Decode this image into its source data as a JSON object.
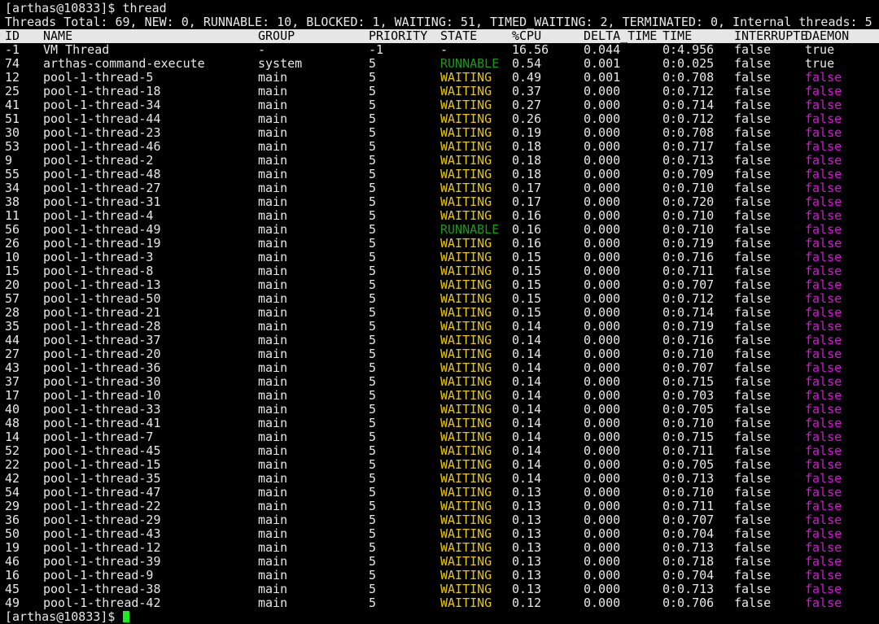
{
  "prompt": "[arthas@10833]$",
  "command": "thread",
  "summary": "Threads Total: 69, NEW: 0, RUNNABLE: 10, BLOCKED: 1, WAITING: 51, TIMED_WAITING: 2, TERMINATED: 0, Internal threads: 5",
  "columns": [
    "ID",
    "NAME",
    "GROUP",
    "PRIORITY",
    "STATE",
    "%CPU",
    "DELTA_TIME",
    "TIME",
    "INTERRUPTE",
    "DAEMON"
  ],
  "rows": [
    [
      "-1",
      "VM Thread",
      "-",
      "-1",
      "-",
      "16.56",
      "0.044",
      "0:4.956",
      "false",
      "true"
    ],
    [
      "74",
      "arthas-command-execute",
      "system",
      "5",
      "RUNNABLE",
      "0.54",
      "0.001",
      "0:0.025",
      "false",
      "true"
    ],
    [
      "12",
      "pool-1-thread-5",
      "main",
      "5",
      "WAITING",
      "0.49",
      "0.001",
      "0:0.708",
      "false",
      "false"
    ],
    [
      "25",
      "pool-1-thread-18",
      "main",
      "5",
      "WAITING",
      "0.37",
      "0.000",
      "0:0.712",
      "false",
      "false"
    ],
    [
      "41",
      "pool-1-thread-34",
      "main",
      "5",
      "WAITING",
      "0.27",
      "0.000",
      "0:0.714",
      "false",
      "false"
    ],
    [
      "51",
      "pool-1-thread-44",
      "main",
      "5",
      "WAITING",
      "0.26",
      "0.000",
      "0:0.712",
      "false",
      "false"
    ],
    [
      "30",
      "pool-1-thread-23",
      "main",
      "5",
      "WAITING",
      "0.19",
      "0.000",
      "0:0.708",
      "false",
      "false"
    ],
    [
      "53",
      "pool-1-thread-46",
      "main",
      "5",
      "WAITING",
      "0.18",
      "0.000",
      "0:0.717",
      "false",
      "false"
    ],
    [
      "9",
      "pool-1-thread-2",
      "main",
      "5",
      "WAITING",
      "0.18",
      "0.000",
      "0:0.713",
      "false",
      "false"
    ],
    [
      "55",
      "pool-1-thread-48",
      "main",
      "5",
      "WAITING",
      "0.18",
      "0.000",
      "0:0.709",
      "false",
      "false"
    ],
    [
      "34",
      "pool-1-thread-27",
      "main",
      "5",
      "WAITING",
      "0.17",
      "0.000",
      "0:0.710",
      "false",
      "false"
    ],
    [
      "38",
      "pool-1-thread-31",
      "main",
      "5",
      "WAITING",
      "0.17",
      "0.000",
      "0:0.720",
      "false",
      "false"
    ],
    [
      "11",
      "pool-1-thread-4",
      "main",
      "5",
      "WAITING",
      "0.16",
      "0.000",
      "0:0.710",
      "false",
      "false"
    ],
    [
      "56",
      "pool-1-thread-49",
      "main",
      "5",
      "RUNNABLE",
      "0.16",
      "0.000",
      "0:0.710",
      "false",
      "false"
    ],
    [
      "26",
      "pool-1-thread-19",
      "main",
      "5",
      "WAITING",
      "0.16",
      "0.000",
      "0:0.719",
      "false",
      "false"
    ],
    [
      "10",
      "pool-1-thread-3",
      "main",
      "5",
      "WAITING",
      "0.15",
      "0.000",
      "0:0.716",
      "false",
      "false"
    ],
    [
      "15",
      "pool-1-thread-8",
      "main",
      "5",
      "WAITING",
      "0.15",
      "0.000",
      "0:0.711",
      "false",
      "false"
    ],
    [
      "20",
      "pool-1-thread-13",
      "main",
      "5",
      "WAITING",
      "0.15",
      "0.000",
      "0:0.707",
      "false",
      "false"
    ],
    [
      "57",
      "pool-1-thread-50",
      "main",
      "5",
      "WAITING",
      "0.15",
      "0.000",
      "0:0.712",
      "false",
      "false"
    ],
    [
      "28",
      "pool-1-thread-21",
      "main",
      "5",
      "WAITING",
      "0.15",
      "0.000",
      "0:0.714",
      "false",
      "false"
    ],
    [
      "35",
      "pool-1-thread-28",
      "main",
      "5",
      "WAITING",
      "0.14",
      "0.000",
      "0:0.719",
      "false",
      "false"
    ],
    [
      "44",
      "pool-1-thread-37",
      "main",
      "5",
      "WAITING",
      "0.14",
      "0.000",
      "0:0.716",
      "false",
      "false"
    ],
    [
      "27",
      "pool-1-thread-20",
      "main",
      "5",
      "WAITING",
      "0.14",
      "0.000",
      "0:0.710",
      "false",
      "false"
    ],
    [
      "43",
      "pool-1-thread-36",
      "main",
      "5",
      "WAITING",
      "0.14",
      "0.000",
      "0:0.707",
      "false",
      "false"
    ],
    [
      "37",
      "pool-1-thread-30",
      "main",
      "5",
      "WAITING",
      "0.14",
      "0.000",
      "0:0.715",
      "false",
      "false"
    ],
    [
      "17",
      "pool-1-thread-10",
      "main",
      "5",
      "WAITING",
      "0.14",
      "0.000",
      "0:0.703",
      "false",
      "false"
    ],
    [
      "40",
      "pool-1-thread-33",
      "main",
      "5",
      "WAITING",
      "0.14",
      "0.000",
      "0:0.705",
      "false",
      "false"
    ],
    [
      "48",
      "pool-1-thread-41",
      "main",
      "5",
      "WAITING",
      "0.14",
      "0.000",
      "0:0.710",
      "false",
      "false"
    ],
    [
      "14",
      "pool-1-thread-7",
      "main",
      "5",
      "WAITING",
      "0.14",
      "0.000",
      "0:0.715",
      "false",
      "false"
    ],
    [
      "52",
      "pool-1-thread-45",
      "main",
      "5",
      "WAITING",
      "0.14",
      "0.000",
      "0:0.711",
      "false",
      "false"
    ],
    [
      "22",
      "pool-1-thread-15",
      "main",
      "5",
      "WAITING",
      "0.14",
      "0.000",
      "0:0.705",
      "false",
      "false"
    ],
    [
      "42",
      "pool-1-thread-35",
      "main",
      "5",
      "WAITING",
      "0.14",
      "0.000",
      "0:0.713",
      "false",
      "false"
    ],
    [
      "54",
      "pool-1-thread-47",
      "main",
      "5",
      "WAITING",
      "0.13",
      "0.000",
      "0:0.710",
      "false",
      "false"
    ],
    [
      "29",
      "pool-1-thread-22",
      "main",
      "5",
      "WAITING",
      "0.13",
      "0.000",
      "0:0.711",
      "false",
      "false"
    ],
    [
      "36",
      "pool-1-thread-29",
      "main",
      "5",
      "WAITING",
      "0.13",
      "0.000",
      "0:0.707",
      "false",
      "false"
    ],
    [
      "50",
      "pool-1-thread-43",
      "main",
      "5",
      "WAITING",
      "0.13",
      "0.000",
      "0:0.704",
      "false",
      "false"
    ],
    [
      "19",
      "pool-1-thread-12",
      "main",
      "5",
      "WAITING",
      "0.13",
      "0.000",
      "0:0.713",
      "false",
      "false"
    ],
    [
      "46",
      "pool-1-thread-39",
      "main",
      "5",
      "WAITING",
      "0.13",
      "0.000",
      "0:0.718",
      "false",
      "false"
    ],
    [
      "16",
      "pool-1-thread-9",
      "main",
      "5",
      "WAITING",
      "0.13",
      "0.000",
      "0:0.704",
      "false",
      "false"
    ],
    [
      "45",
      "pool-1-thread-38",
      "main",
      "5",
      "WAITING",
      "0.13",
      "0.000",
      "0:0.713",
      "false",
      "false"
    ],
    [
      "49",
      "pool-1-thread-42",
      "main",
      "5",
      "WAITING",
      "0.12",
      "0.000",
      "0:0.706",
      "false",
      "false"
    ]
  ],
  "colors": {
    "background": "#000000",
    "text": "#e8e8e8",
    "waiting": "#e6c619",
    "runnable": "#1a9a1a",
    "daemon_false": "#d418d4",
    "cursor": "#1ee81e",
    "header_bg": "#e6e6e6"
  }
}
